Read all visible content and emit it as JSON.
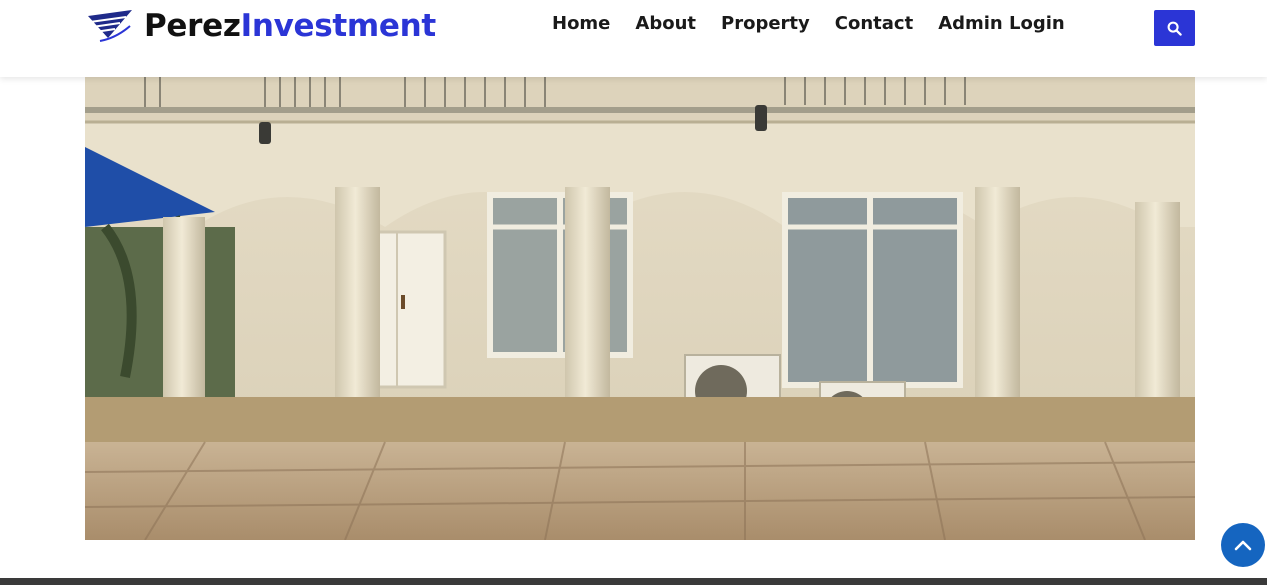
{
  "brand": {
    "part1": "Perez",
    "part2": "Investment",
    "accent_color": "#2b35d6"
  },
  "nav": {
    "items": [
      {
        "label": "Home"
      },
      {
        "label": "About"
      },
      {
        "label": "Property"
      },
      {
        "label": "Contact"
      },
      {
        "label": "Admin Login"
      }
    ]
  },
  "icons": {
    "search": "search-icon",
    "back_to_top": "chevron-up-icon",
    "logo": "logo-icon"
  },
  "photo": {
    "subject": "property-photo"
  }
}
